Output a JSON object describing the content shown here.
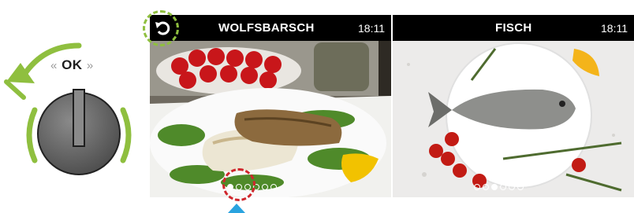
{
  "knob": {
    "ok_label": "OK",
    "left_arrow": "«",
    "right_arrow": "»",
    "accent_color": "#8fbf3f"
  },
  "screens": [
    {
      "title": "WOLFSBARSCH",
      "time": "18:11",
      "icon": "back-icon",
      "page_count": 6,
      "active_page": 1
    },
    {
      "title": "FISCH",
      "time": "18:11",
      "page_count": 6,
      "active_page": 3
    }
  ],
  "annotations": {
    "back_highlight_color": "#8fbf3f",
    "dot_highlight_color": "#d0262c",
    "pointer_color": "#2aa3df"
  }
}
